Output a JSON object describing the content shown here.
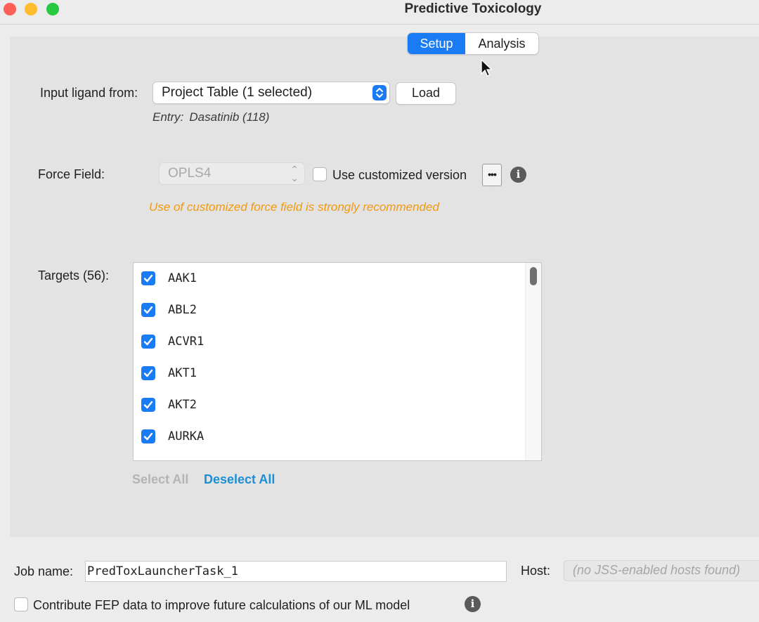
{
  "window": {
    "title": "Predictive Toxicology"
  },
  "tabs": [
    {
      "label": "Setup",
      "active": true
    },
    {
      "label": "Analysis",
      "active": false
    }
  ],
  "input": {
    "label": "Input ligand from:",
    "source_value": "Project Table (1 selected)",
    "load_label": "Load",
    "entry_key": "Entry:",
    "entry_value": "Dasatinib (118)"
  },
  "force_field": {
    "label": "Force Field:",
    "value": "OPLS4",
    "custom_label": "Use customized version",
    "custom_checked": false,
    "more_label": "•••",
    "warning": "Use of customized force field is strongly recommended"
  },
  "targets": {
    "label": "Targets (56):",
    "items": [
      {
        "name": "AAK1",
        "checked": true
      },
      {
        "name": "ABL2",
        "checked": true
      },
      {
        "name": "ACVR1",
        "checked": true
      },
      {
        "name": "AKT1",
        "checked": true
      },
      {
        "name": "AKT2",
        "checked": true
      },
      {
        "name": "AURKA",
        "checked": true
      }
    ],
    "select_all": "Select All",
    "deselect_all": "Deselect All"
  },
  "job": {
    "name_label": "Job name:",
    "name_value": "PredToxLauncherTask_1",
    "host_label": "Host:",
    "host_placeholder": "(no JSS-enabled hosts found)"
  },
  "contribute": {
    "label": "Contribute FEP data to improve future calculations of our ML model",
    "checked": false
  },
  "colors": {
    "accent": "#1a7cf5",
    "warning": "#f09a0f",
    "link": "#1b8fd6"
  }
}
